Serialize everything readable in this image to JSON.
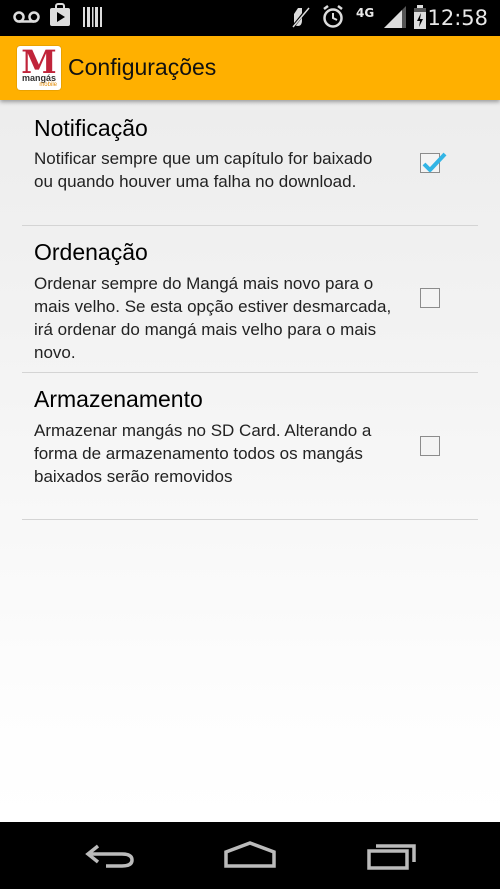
{
  "status_bar": {
    "time": "12:58",
    "network_type": "4G",
    "icons": [
      "voicemail-icon",
      "play-store-icon",
      "barcode-icon",
      "mute-icon",
      "alarm-icon",
      "signal-icon",
      "battery-icon"
    ]
  },
  "action_bar": {
    "logo_letter": "M",
    "logo_text": "mangás",
    "logo_subtext": "mobile",
    "title": "Configurações",
    "background_color": "#ffb000"
  },
  "preferences": [
    {
      "title": "Notificação",
      "summary": "Notificar sempre que um capítulo for baixado ou quando houver uma falha no download.",
      "checked": true
    },
    {
      "title": "Ordenação",
      "summary": "Ordenar sempre do Mangá mais novo para o mais velho. Se esta opção estiver desmarcada, irá ordenar do mangá mais velho para o mais novo.",
      "checked": false
    },
    {
      "title": "Armazenamento",
      "summary": "Armazenar mangás no SD Card. Alterando a forma de armazenamento todos os mangás baixados serão removidos",
      "checked": false
    }
  ],
  "nav_bar": {
    "icons": [
      "back-icon",
      "home-icon",
      "recent-apps-icon"
    ]
  },
  "colors": {
    "check_mark": "#33b5e5",
    "divider": "#d4d4d4"
  }
}
